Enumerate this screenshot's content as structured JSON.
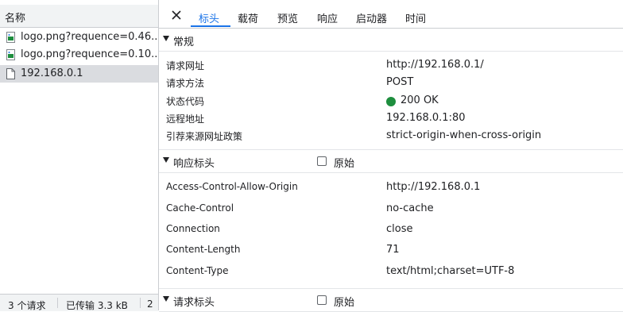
{
  "request_list": {
    "header": "名称",
    "items": [
      {
        "name": "logo.png?requence=0.46...",
        "icon": "image-file-icon"
      },
      {
        "name": "logo.png?requence=0.10...",
        "icon": "image-file-icon"
      },
      {
        "name": "192.168.0.1",
        "icon": "document-icon",
        "selected": true
      }
    ],
    "footer": {
      "requests": "3 个请求",
      "transferred": "已传输 3.3 kB",
      "extra": "2"
    }
  },
  "tabs": [
    "标头",
    "载荷",
    "预览",
    "响应",
    "启动器",
    "时间"
  ],
  "active_tab": "标头",
  "general": {
    "title": "常规",
    "rows": [
      {
        "key": "请求网址",
        "value": "http://192.168.0.1/"
      },
      {
        "key": "请求方法",
        "value": "POST"
      },
      {
        "key": "状态代码",
        "value": "200 OK"
      },
      {
        "key": "远程地址",
        "value": "192.168.0.1:80"
      },
      {
        "key": "引荐来源网址政策",
        "value": "strict-origin-when-cross-origin"
      }
    ]
  },
  "response_headers": {
    "title": "响应标头",
    "raw_label": "原始",
    "rows": [
      {
        "key": "Access-Control-Allow-Origin",
        "value": "http://192.168.0.1"
      },
      {
        "key": "Cache-Control",
        "value": "no-cache"
      },
      {
        "key": "Connection",
        "value": "close"
      },
      {
        "key": "Content-Length",
        "value": "71"
      },
      {
        "key": "Content-Type",
        "value": "text/html;charset=UTF-8"
      }
    ]
  },
  "request_headers": {
    "title": "请求标头",
    "raw_label": "原始"
  },
  "colors": {
    "accent": "#1a73e8",
    "status_ok": "#1e8e3e",
    "panel_bg": "#f1f3f4"
  }
}
